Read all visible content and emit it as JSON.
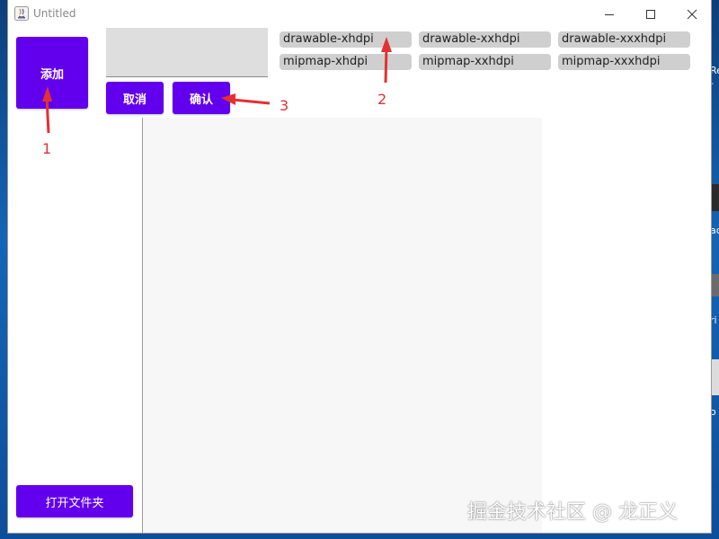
{
  "window": {
    "title": "Untitled"
  },
  "buttons": {
    "add": "添加",
    "cancel": "取消",
    "confirm": "确认",
    "open_folder": "打开文件夹"
  },
  "textarea": {
    "value": ""
  },
  "chips": [
    "drawable-xhdpi",
    "drawable-xxhdpi",
    "drawable-xxxhdpi",
    "mipmap-xhdpi",
    "mipmap-xxhdpi",
    "mipmap-xxxhdpi"
  ],
  "annotations": {
    "one": "1",
    "two": "2",
    "three": "3"
  },
  "watermark": "掘金技术社区 @ 龙正义",
  "desktop_fragments": [
    "Re",
    "-",
    "ac",
    "ri",
    "o"
  ],
  "colors": {
    "accent": "#6200ee",
    "chip_bg": "#cfcfcf",
    "annotation": "#e53030"
  }
}
